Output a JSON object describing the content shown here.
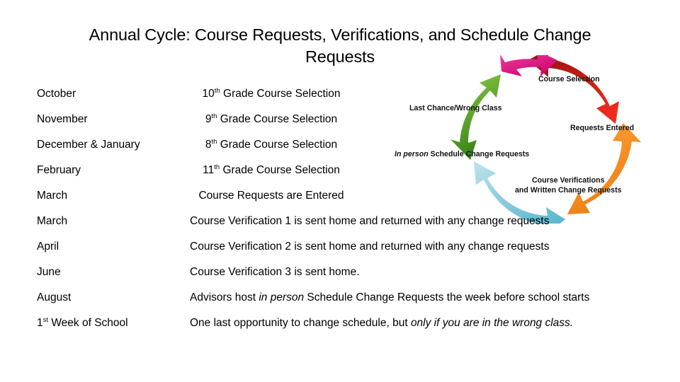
{
  "slide": {
    "title": "Annual Cycle: Course Requests, Verifications, and Schedule Change\nRequests",
    "background_color": "#ffffff",
    "text_color": "#000000"
  },
  "schedule": {
    "rows": [
      {
        "month": "October",
        "ordinal": "10",
        "ordinal_suffix": "th",
        "desc_prefix": "",
        "desc_rest": " Grade Course Selection",
        "align": "narrow"
      },
      {
        "month": "November",
        "ordinal": "9",
        "ordinal_suffix": "th",
        "desc_prefix": "",
        "desc_rest": " Grade Course Selection",
        "align": "narrow"
      },
      {
        "month": "December & January",
        "ordinal": "8",
        "ordinal_suffix": "th",
        "desc_prefix": "",
        "desc_rest": " Grade Course Selection",
        "align": "narrow"
      },
      {
        "month": "February",
        "ordinal": "11",
        "ordinal_suffix": "th",
        "desc_prefix": "",
        "desc_rest": " Grade Course Selection",
        "align": "narrow"
      },
      {
        "month": "March",
        "ordinal": "",
        "ordinal_suffix": "",
        "desc_prefix": "",
        "desc_rest": "Course Requests are Entered",
        "align": "narrow"
      },
      {
        "month": "March",
        "ordinal": "",
        "ordinal_suffix": "",
        "desc_prefix": "",
        "desc_rest": "Course Verification 1 is sent home and returned with any change requests",
        "align": "wide"
      },
      {
        "month": "April",
        "ordinal": "",
        "ordinal_suffix": "",
        "desc_prefix": "",
        "desc_rest": "Course Verification 2 is sent home and returned with any change requests",
        "align": "wide"
      },
      {
        "month": "June",
        "ordinal": "",
        "ordinal_suffix": "",
        "desc_prefix": "",
        "desc_rest": "Course Verification 3 is sent home.",
        "align": "wide"
      },
      {
        "month": "August",
        "ordinal": "",
        "ordinal_suffix": "",
        "desc_prefix": "Advisors host ",
        "italic": "in person",
        "desc_rest": " Schedule Change Requests the week before school starts",
        "align": "wide"
      },
      {
        "month": "1st Week of School",
        "month_ordinal": "1",
        "month_ordinal_suffix": "st",
        "month_rest": " Week of School",
        "ordinal": "",
        "ordinal_suffix": "",
        "desc_prefix": "One last opportunity to change schedule, but ",
        "italic": "only if you are in the wrong class.",
        "desc_rest": "",
        "align": "wide"
      }
    ]
  },
  "cycle_diagram": {
    "type": "circular-arrow-cycle",
    "segment_count": 5,
    "direction": "clockwise",
    "segments": [
      {
        "name": "course-selection",
        "label": "Course Selection",
        "color_from": "#8E0F0F",
        "color_to": "#EE2B1D",
        "position": "top"
      },
      {
        "name": "requests-entered",
        "label": "Requests Entered",
        "color_from": "#F7941E",
        "color_to": "#F58220",
        "position": "right"
      },
      {
        "name": "course-verifications",
        "label": "Course Verifications\nand Written Change Requests",
        "color_from": "#A8D9E6",
        "color_to": "#5FB9CE",
        "position": "bottom"
      },
      {
        "name": "schedule-changes",
        "label": "In person Schedule Change Requests",
        "label_italic": "In person",
        "label_rest": " Schedule Change Requests",
        "color_from": "#7DC242",
        "color_to": "#2F7D17",
        "position": "left-bottom"
      },
      {
        "name": "last-chance",
        "label": "Last Chance/Wrong Class",
        "color_from": "#F0208C",
        "color_to": "#C8006E",
        "position": "left-top"
      }
    ]
  }
}
